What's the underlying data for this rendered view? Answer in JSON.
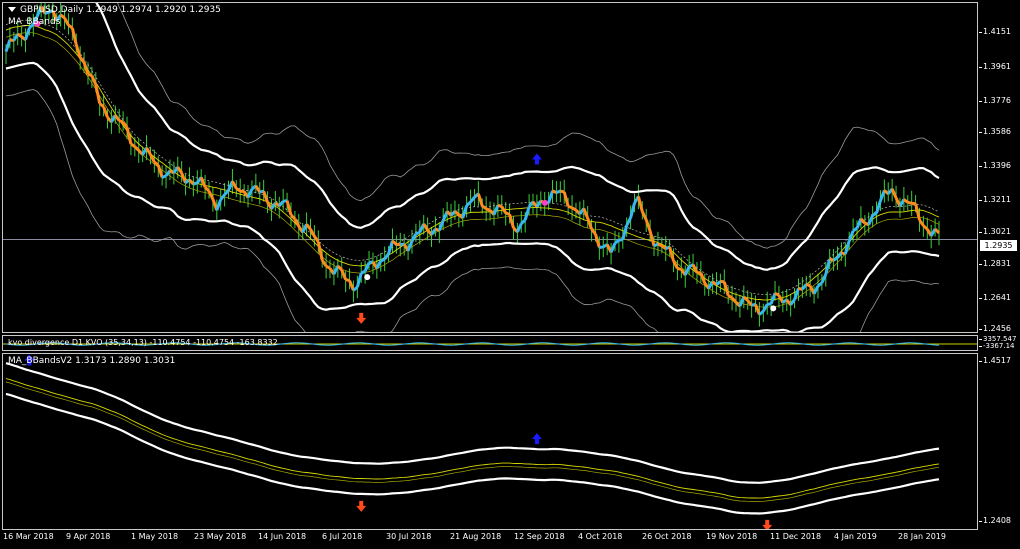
{
  "main": {
    "symbol_line": "GBPUSD,Daily",
    "ohlc_line": "1.2949 1.2974 1.2920 1.2935",
    "indicator_label": "MA_BBands",
    "current_price": "1.2935",
    "price_ticks": [
      "1.4151",
      "1.3961",
      "1.3776",
      "1.3586",
      "1.3396",
      "1.3211",
      "1.3021",
      "1.2831",
      "1.2641",
      "1.2456"
    ]
  },
  "kvo": {
    "title": "kvo divergence  D1  KVO (35,34,13) -110.4754 -110.4754 -163.8332",
    "ticks": [
      "3357.547",
      "-3367.14"
    ]
  },
  "bb": {
    "title": "MA_BBandsV2 1.3173 1.2890 1.3031",
    "ticks": [
      "1.4517",
      "1.2408"
    ]
  },
  "time_axis": [
    "16 Mar 2018",
    "9 Apr 2018",
    "1 May 2018",
    "23 May 2018",
    "14 Jun 2018",
    "6 Jul 2018",
    "30 Jul 2018",
    "21 Aug 2018",
    "12 Sep 2018",
    "4 Oct 2018",
    "26 Oct 2018",
    "19 Nov 2018",
    "11 Dec 2018",
    "4 Jan 2019",
    "28 Jan 2019"
  ],
  "colors": {
    "up_arrow": "#1a1aff",
    "down_arrow": "#ff4a1a",
    "up_line": "#38b8f0",
    "down_line": "#ff8a20",
    "candles": "#39d23a",
    "band": "#ffffff",
    "mid": "#d9d900"
  },
  "chart_data": {
    "type": "line",
    "series": [
      {
        "values": [
          1.398,
          1.412,
          1.423,
          1.405,
          1.37,
          1.356,
          1.34,
          1.33,
          1.328,
          1.315,
          1.323,
          1.318,
          1.311,
          1.298,
          1.276,
          1.269,
          1.283,
          1.291,
          1.298,
          1.305,
          1.315,
          1.311,
          1.301,
          1.317,
          1.318,
          1.302,
          1.284,
          1.315,
          1.29,
          1.278,
          1.272,
          1.264,
          1.255,
          1.259,
          1.263,
          1.271,
          1.291,
          1.306,
          1.321,
          1.309,
          1.2935
        ]
      }
    ],
    "ylim": [
      1.241,
      1.425
    ]
  }
}
